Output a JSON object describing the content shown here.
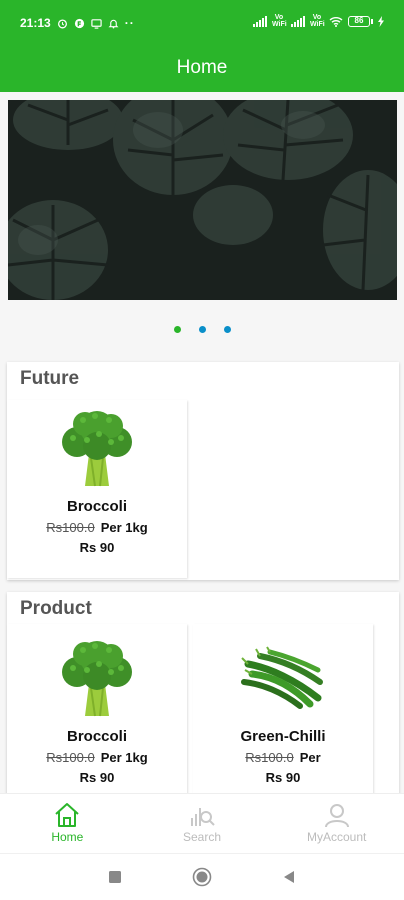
{
  "status_bar": {
    "time": "21:13",
    "vowifi_1": "Vo WiFi",
    "vowifi_2": "Vo WiFi",
    "battery": "86"
  },
  "app_bar": {
    "title": "Home"
  },
  "carousel": {
    "page_count": 3,
    "active_index": 0
  },
  "colors": {
    "brand_green": "#2ab52a",
    "dot_blue": "#0a8fc9",
    "inactive_grey": "#bcbcbc"
  },
  "sections": {
    "future": {
      "title": "Future",
      "items": [
        {
          "name": "Broccoli",
          "old_price": "Rs100.0",
          "unit": "Per 1kg",
          "price": "Rs 90",
          "image": "broccoli-image"
        }
      ]
    },
    "product": {
      "title": "Product",
      "items": [
        {
          "name": "Broccoli",
          "old_price": "Rs100.0",
          "unit": "Per 1kg",
          "price": "Rs 90",
          "image": "broccoli-image"
        },
        {
          "name": "Green-Chilli",
          "old_price": "Rs100.0",
          "unit": "Per",
          "price": "Rs 90",
          "image": "green-chilli-image"
        }
      ]
    }
  },
  "bottom_nav": {
    "items": [
      {
        "label": "Home",
        "icon": "home-icon",
        "active": true
      },
      {
        "label": "Search",
        "icon": "search-icon",
        "active": false
      },
      {
        "label": "MyAccount",
        "icon": "account-icon",
        "active": false
      }
    ]
  },
  "system_nav": {
    "icons": [
      "recent-apps-icon",
      "home-circle-icon",
      "back-icon"
    ]
  }
}
